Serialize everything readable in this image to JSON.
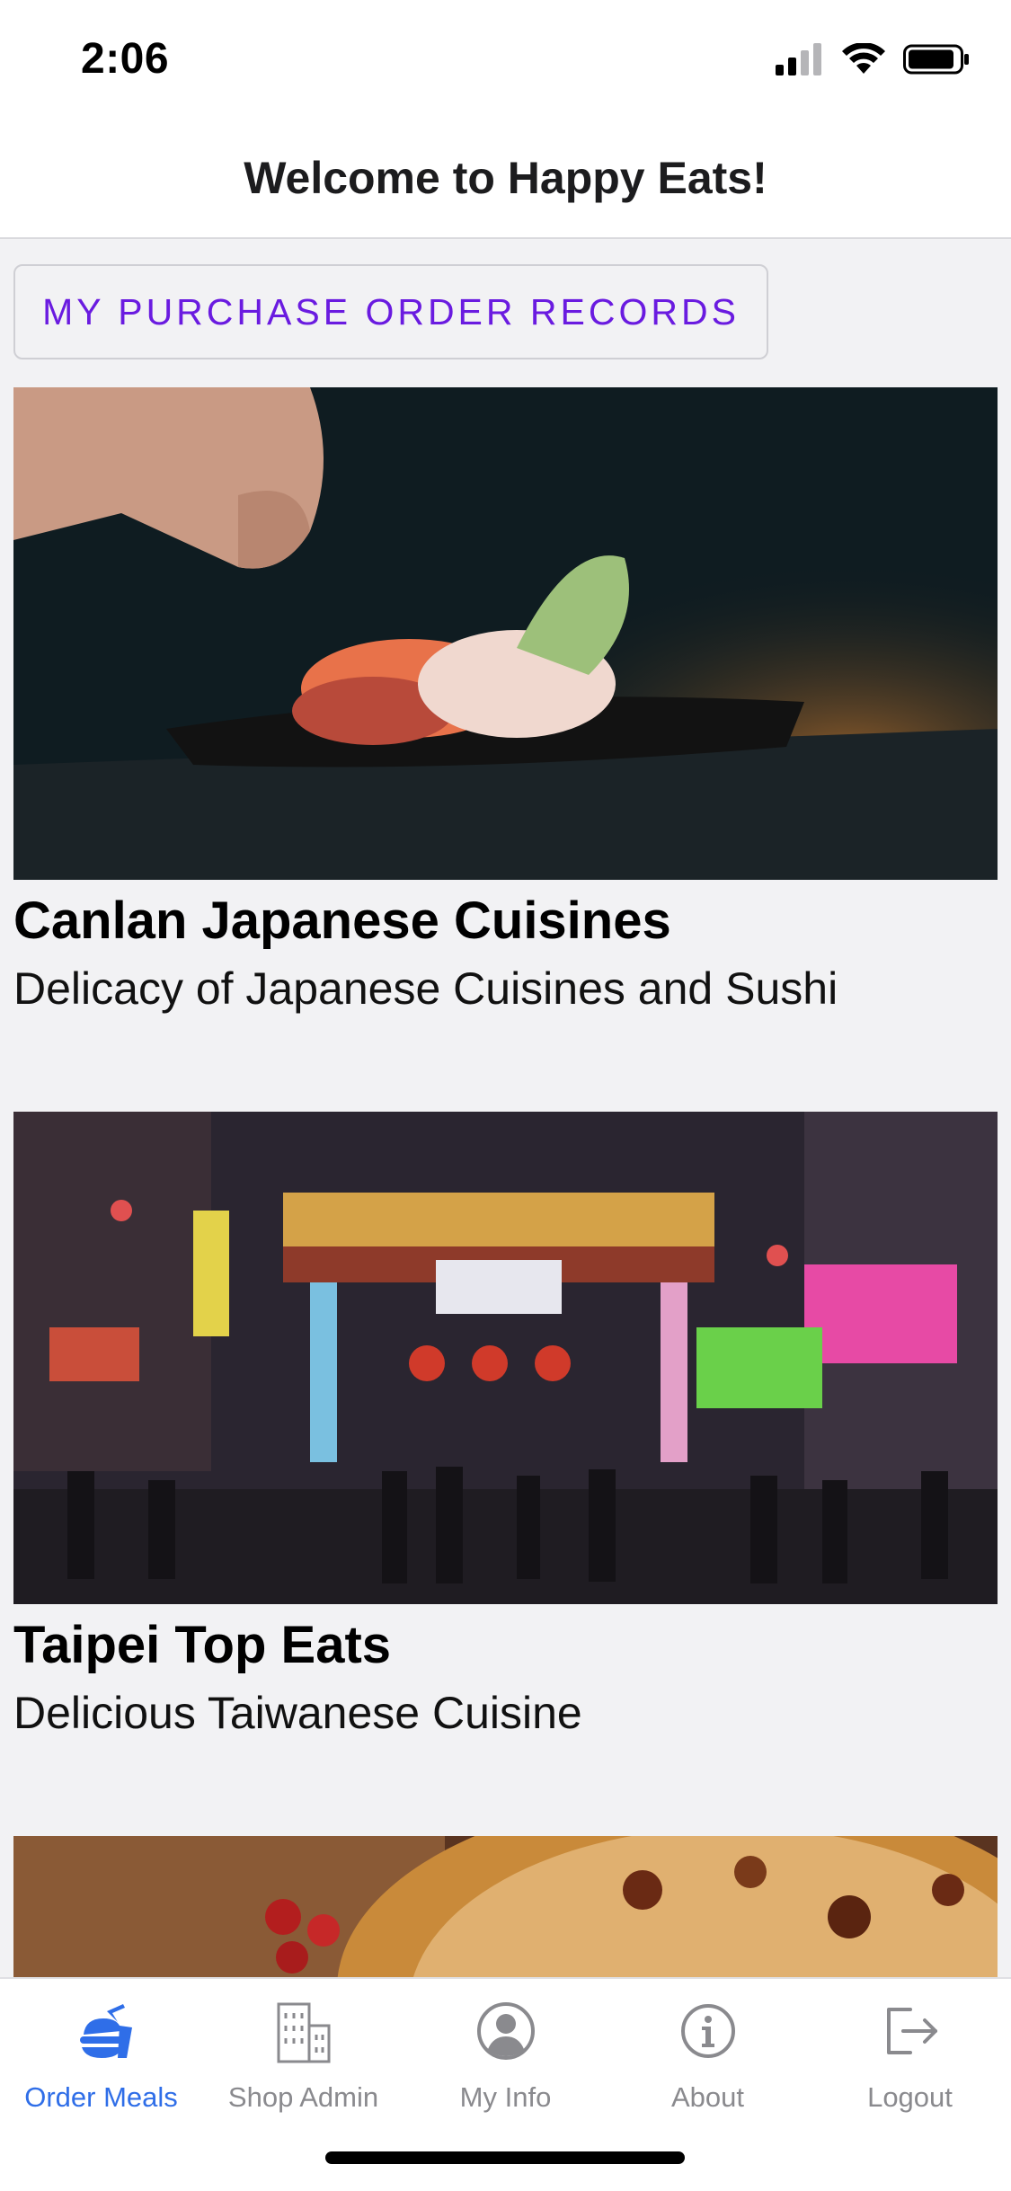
{
  "status_bar": {
    "time": "2:06"
  },
  "header": {
    "title": "Welcome to Happy Eats!"
  },
  "records_button": {
    "label": "MY PURCHASE ORDER RECORDS"
  },
  "restaurants": [
    {
      "name": "Canlan Japanese Cuisines",
      "description": "Delicacy of Japanese Cuisines and Sushi"
    },
    {
      "name": "Taipei Top Eats",
      "description": "Delicious Taiwanese Cuisine"
    }
  ],
  "tabs": [
    {
      "label": "Order Meals",
      "icon": "burger-meal-icon",
      "active": true
    },
    {
      "label": "Shop Admin",
      "icon": "building-icon",
      "active": false
    },
    {
      "label": "My Info",
      "icon": "user-circle-icon",
      "active": false
    },
    {
      "label": "About",
      "icon": "info-icon",
      "active": false
    },
    {
      "label": "Logout",
      "icon": "logout-icon",
      "active": false
    }
  ],
  "colors": {
    "accent": "#2f6ee8",
    "button_text": "#6a1be0",
    "inactive_tab": "#8a8a8e"
  }
}
